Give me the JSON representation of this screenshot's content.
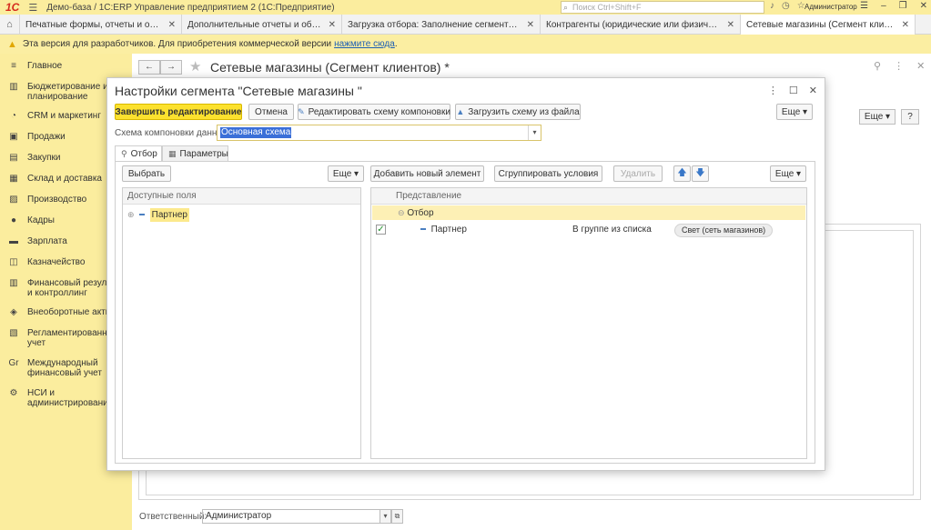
{
  "titlebar": {
    "logo": "1С",
    "app_title": "Демо-база / 1С:ERP Управление предприятием 2  (1С:Предприятие)",
    "search_placeholder": "Поиск Ctrl+Shift+F",
    "user": "Администратор"
  },
  "tabs": [
    {
      "label": "Печатные формы, отчеты и обработки"
    },
    {
      "label": "Дополнительные отчеты и обработки"
    },
    {
      "label": "Загрузка отбора: Заполнение сегментов партн..."
    },
    {
      "label": "Контрагенты (юридические или физические ..."
    },
    {
      "label": "Сетевые магазины (Сегмент клиентов) *"
    }
  ],
  "banner": {
    "text": "Эта версия для разработчиков. Для приобретения коммерческой версии",
    "link": "нажмите сюда",
    "tail": "."
  },
  "sidebar": {
    "items": [
      {
        "label": "Главное",
        "icon": "≡"
      },
      {
        "label": "Бюджетирование и планирование",
        "icon": "▥"
      },
      {
        "label": "CRM и маркетинг",
        "icon": "◔"
      },
      {
        "label": "Продажи",
        "icon": "▣"
      },
      {
        "label": "Закупки",
        "icon": "▤"
      },
      {
        "label": "Склад и доставка",
        "icon": "▦"
      },
      {
        "label": "Производство",
        "icon": "▨"
      },
      {
        "label": "Кадры",
        "icon": "●"
      },
      {
        "label": "Зарплата",
        "icon": "▬"
      },
      {
        "label": "Казначейство",
        "icon": "◫"
      },
      {
        "label": "Финансовый результат и контроллинг",
        "icon": "▥"
      },
      {
        "label": "Внеоборотные активы",
        "icon": "◈"
      },
      {
        "label": "Регламентированный учет",
        "icon": "▧"
      },
      {
        "label": "Международный финансовый учет",
        "icon": "Gr"
      },
      {
        "label": "НСИ и администрирование",
        "icon": "⚙"
      }
    ]
  },
  "background_form": {
    "title": "Сетевые магазины (Сегмент клиентов) *",
    "more_label": "Еще",
    "help_label": "?",
    "responsible_label": "Ответственный:",
    "responsible_value": "Администратор"
  },
  "dialog": {
    "title": "Настройки сегмента \"Сетевые магазины \"",
    "finish_label": "Завершить редактирование",
    "cancel_label": "Отмена",
    "edit_schema_label": "Редактировать схему компоновки",
    "load_schema_label": "Загрузить схему из файла",
    "more_label": "Еще",
    "schema_label": "Схема компоновки данных:",
    "schema_value": "Основная схема",
    "tab_filter": "Отбор",
    "tab_params": "Параметры",
    "select_label": "Выбрать",
    "add_element_label": "Добавить новый элемент",
    "group_conditions_label": "Сгруппировать условия",
    "delete_label": "Удалить",
    "available_fields_header": "Доступные поля",
    "available_fields": [
      "Партнер"
    ],
    "representation_header": "Представление",
    "filter_group": "Отбор",
    "filter_row": {
      "field": "Партнер",
      "condition": "В группе из списка",
      "value": "Свет (сеть магазинов)",
      "checked": true
    }
  }
}
